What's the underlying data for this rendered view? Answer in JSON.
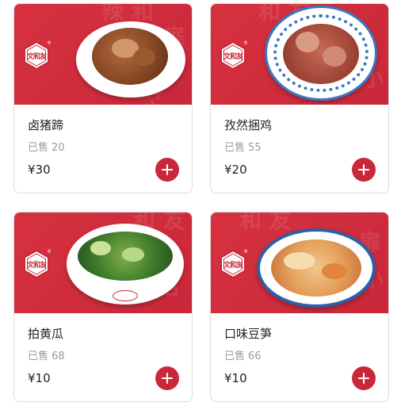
{
  "brand": {
    "logo_text": "文和友",
    "registered_mark": "®",
    "colors": {
      "accent": "#c8283a",
      "banner": "#d7313f"
    }
  },
  "sold_prefix": "已售",
  "products": [
    {
      "name": "卤猪蹄",
      "sold": "20",
      "price": "¥30",
      "add_icon": "plus-circle-icon"
    },
    {
      "name": "孜然捆鸡",
      "sold": "55",
      "price": "¥20",
      "add_icon": "plus-circle-icon"
    },
    {
      "name": "拍黄瓜",
      "sold": "68",
      "price": "¥10",
      "add_icon": "plus-circle-icon"
    },
    {
      "name": "口味豆笋",
      "sold": "66",
      "price": "¥10",
      "add_icon": "plus-circle-icon"
    }
  ]
}
